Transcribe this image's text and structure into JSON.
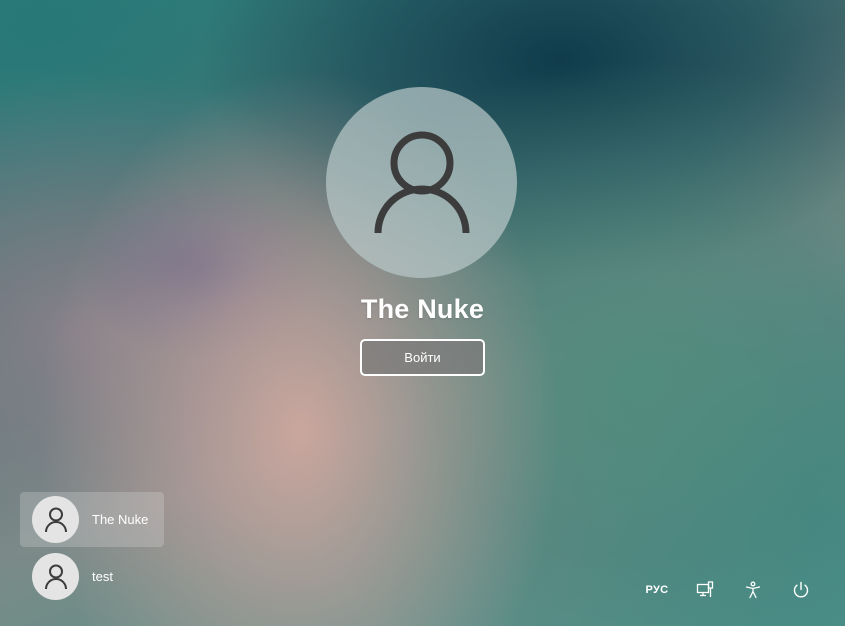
{
  "login": {
    "user_name": "The Nuke",
    "signin_label": "Войти"
  },
  "users": [
    {
      "name": "The Nuke",
      "selected": true
    },
    {
      "name": "test",
      "selected": false
    }
  ],
  "tray": {
    "language": "РУС",
    "icons": [
      "network-icon",
      "accessibility-icon",
      "power-icon"
    ]
  },
  "colors": {
    "text": "#ffffff",
    "avatar_glyph": "#3c3c3c"
  }
}
